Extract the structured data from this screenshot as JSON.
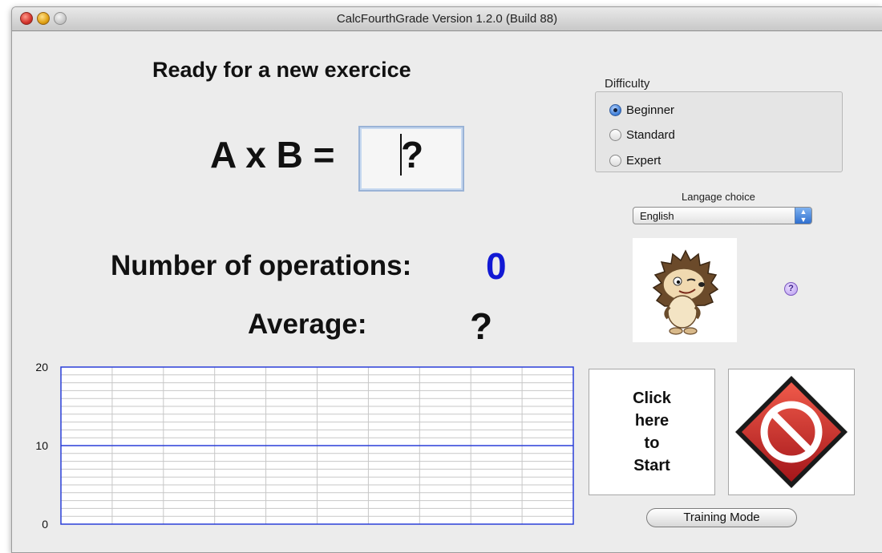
{
  "window": {
    "title": "CalcFourthGrade  Version 1.2.0 (Build 88)"
  },
  "main": {
    "status_text": "Ready for a new exercice",
    "equation": "A x B =",
    "answer_placeholder": "?",
    "operations_label": "Number of operations:",
    "operations_count": "0",
    "average_label": "Average:",
    "average_value": "?"
  },
  "chart_data": {
    "type": "line",
    "title": "",
    "xlabel": "",
    "ylabel": "",
    "ylim": [
      0,
      20
    ],
    "yticks": [
      "20",
      "10",
      "0"
    ],
    "series": [],
    "grid": true,
    "reference_line": 10
  },
  "difficulty": {
    "label": "Difficulty",
    "options": [
      {
        "label": "Beginner",
        "selected": true
      },
      {
        "label": "Standard",
        "selected": false
      },
      {
        "label": "Expert",
        "selected": false
      }
    ]
  },
  "language": {
    "label": "Langage choice",
    "selected": "English"
  },
  "buttons": {
    "start_lines": [
      "Click",
      "here",
      "to",
      "Start"
    ],
    "training_mode": "Training Mode"
  },
  "colors": {
    "accent_blue": "#1219d4",
    "chart_line": "#2a3fd8",
    "stop_red": "#d22d2d"
  },
  "icons": {
    "help": "question-mark-icon",
    "stop": "no-entry-icon",
    "mascot": "hedgehog-mascot"
  }
}
